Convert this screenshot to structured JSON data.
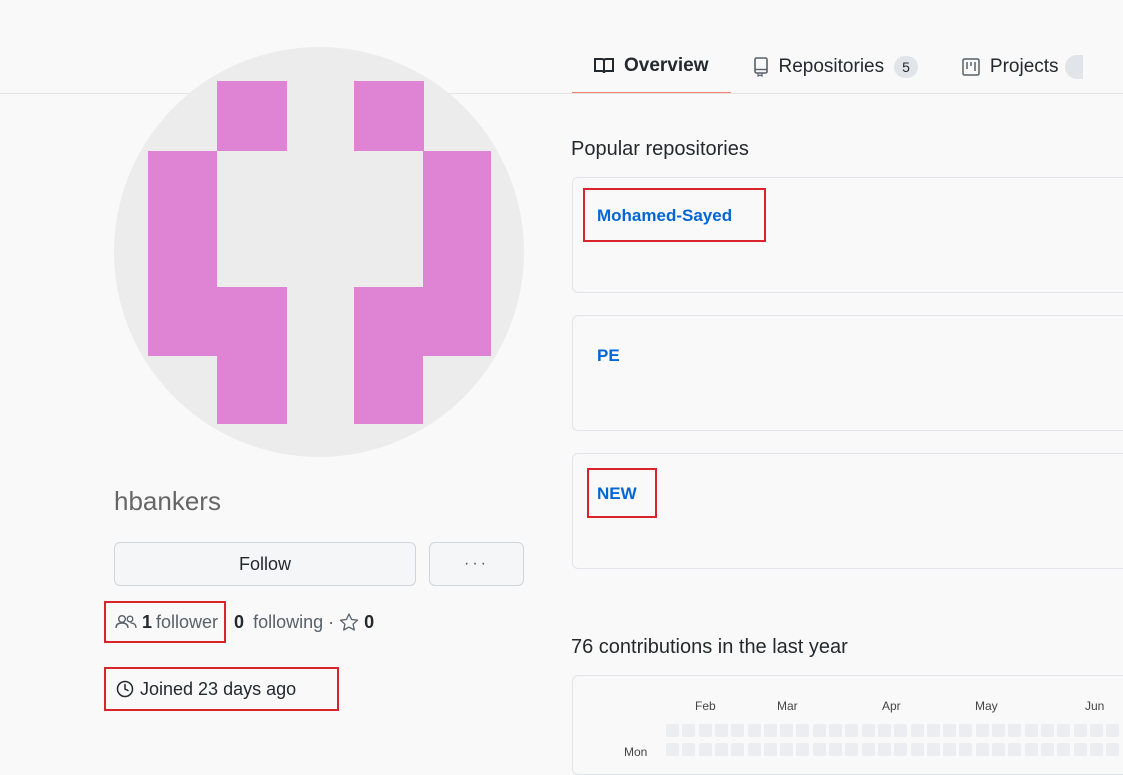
{
  "tabs": [
    {
      "label": "Overview",
      "icon": "book-icon",
      "selected": true
    },
    {
      "label": "Repositories",
      "icon": "repo-icon",
      "count": "5"
    },
    {
      "label": "Projects",
      "icon": "project-icon"
    }
  ],
  "profile": {
    "username": "hbankers",
    "follow_label": "Follow",
    "more_label": "···",
    "followers_count": "1",
    "followers_label": "follower",
    "following_count": "0",
    "following_label": "following",
    "separator": "·",
    "stars_count": "0",
    "joined": "Joined 23 days ago"
  },
  "popular": {
    "title": "Popular repositories",
    "repos": [
      {
        "name": "Mohamed-Sayed",
        "highlighted": true
      },
      {
        "name": "PE",
        "highlighted": false
      },
      {
        "name": "NEW",
        "highlighted": true
      }
    ]
  },
  "contributions": {
    "title": "76 contributions in the last year",
    "months": [
      "Feb",
      "Mar",
      "Apr",
      "May",
      "Jun"
    ],
    "day_label": "Mon"
  },
  "colors": {
    "accent_tab": "#f9826c",
    "link": "#0366d6",
    "highlight": "#d9232d",
    "avatar_pixel": "#df84d4"
  }
}
